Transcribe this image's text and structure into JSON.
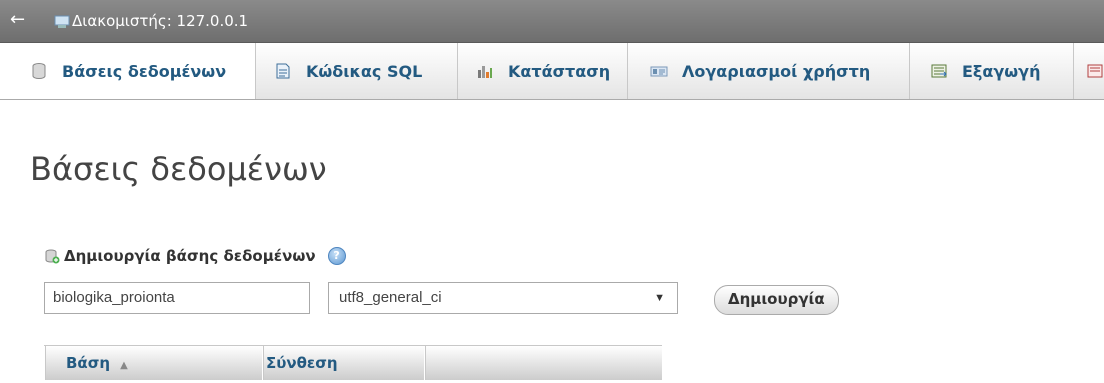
{
  "topbar": {
    "back_arrow": "←",
    "server_label": "Διακομιστής: 127.0.0.1"
  },
  "tabs": [
    {
      "label": "Βάσεις δεδομένων",
      "icon": "database-icon"
    },
    {
      "label": "Κώδικας SQL",
      "icon": "sql-icon"
    },
    {
      "label": "Κατάσταση",
      "icon": "status-icon"
    },
    {
      "label": "Λογαριασμοί χρήστη",
      "icon": "users-icon"
    },
    {
      "label": "Εξαγωγή",
      "icon": "export-icon"
    },
    {
      "label": "",
      "icon": "import-icon"
    }
  ],
  "main": {
    "title": "Βάσεις δεδομένων",
    "create": {
      "heading": "Δημιουργία βάσης δεδομένων",
      "dbname_value": "biologika_proionta",
      "collation_value": "utf8_general_ci",
      "create_button": "Δημιουργία"
    },
    "table": {
      "headers": [
        "Βάση",
        "Σύνθεση"
      ]
    }
  },
  "colors": {
    "link": "#235a81",
    "topbar": "#7a7a7a"
  }
}
